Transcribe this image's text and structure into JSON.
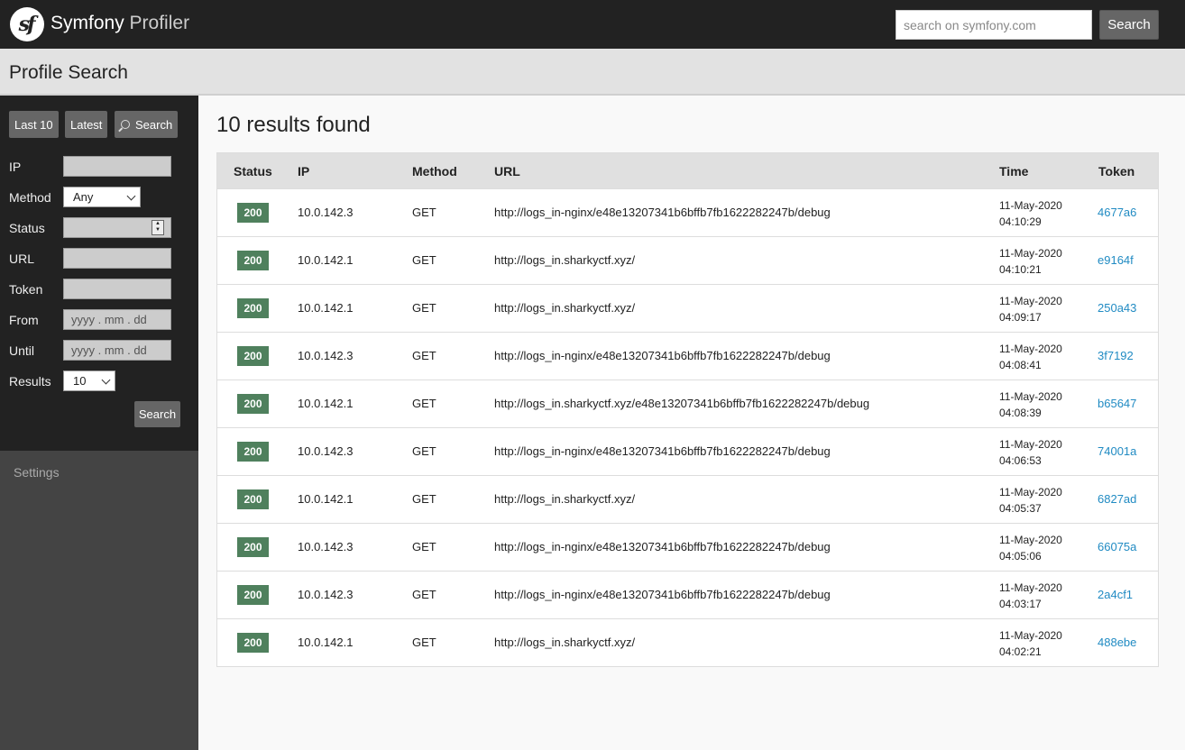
{
  "header": {
    "logo_text": "sf",
    "brand_bold": "Symfony",
    "brand_light": "Profiler",
    "search_placeholder": "search on symfony.com",
    "search_button": "Search"
  },
  "summary": {
    "title": "Profile Search"
  },
  "sidebar": {
    "tabs": {
      "last10": "Last 10",
      "latest": "Latest",
      "search": "Search"
    },
    "labels": {
      "ip": "IP",
      "method": "Method",
      "status": "Status",
      "url": "URL",
      "token": "Token",
      "from": "From",
      "until": "Until",
      "results": "Results"
    },
    "method_value": "Any",
    "date_placeholder": "yyyy . mm . dd",
    "results_value": "10",
    "search_button": "Search",
    "settings": "Settings"
  },
  "content": {
    "heading": "10 results found",
    "columns": {
      "status": "Status",
      "ip": "IP",
      "method": "Method",
      "url": "URL",
      "time": "Time",
      "token": "Token"
    },
    "rows": [
      {
        "status": "200",
        "ip": "10.0.142.3",
        "method": "GET",
        "url": "http://logs_in-nginx/e48e13207341b6bffb7fb1622282247b/debug",
        "date": "11-May-2020",
        "time": "04:10:29",
        "token": "4677a6"
      },
      {
        "status": "200",
        "ip": "10.0.142.1",
        "method": "GET",
        "url": "http://logs_in.sharkyctf.xyz/",
        "date": "11-May-2020",
        "time": "04:10:21",
        "token": "e9164f"
      },
      {
        "status": "200",
        "ip": "10.0.142.1",
        "method": "GET",
        "url": "http://logs_in.sharkyctf.xyz/",
        "date": "11-May-2020",
        "time": "04:09:17",
        "token": "250a43"
      },
      {
        "status": "200",
        "ip": "10.0.142.3",
        "method": "GET",
        "url": "http://logs_in-nginx/e48e13207341b6bffb7fb1622282247b/debug",
        "date": "11-May-2020",
        "time": "04:08:41",
        "token": "3f7192"
      },
      {
        "status": "200",
        "ip": "10.0.142.1",
        "method": "GET",
        "url": "http://logs_in.sharkyctf.xyz/e48e13207341b6bffb7fb1622282247b/debug",
        "date": "11-May-2020",
        "time": "04:08:39",
        "token": "b65647"
      },
      {
        "status": "200",
        "ip": "10.0.142.3",
        "method": "GET",
        "url": "http://logs_in-nginx/e48e13207341b6bffb7fb1622282247b/debug",
        "date": "11-May-2020",
        "time": "04:06:53",
        "token": "74001a"
      },
      {
        "status": "200",
        "ip": "10.0.142.1",
        "method": "GET",
        "url": "http://logs_in.sharkyctf.xyz/",
        "date": "11-May-2020",
        "time": "04:05:37",
        "token": "6827ad"
      },
      {
        "status": "200",
        "ip": "10.0.142.3",
        "method": "GET",
        "url": "http://logs_in-nginx/e48e13207341b6bffb7fb1622282247b/debug",
        "date": "11-May-2020",
        "time": "04:05:06",
        "token": "66075a"
      },
      {
        "status": "200",
        "ip": "10.0.142.3",
        "method": "GET",
        "url": "http://logs_in-nginx/e48e13207341b6bffb7fb1622282247b/debug",
        "date": "11-May-2020",
        "time": "04:03:17",
        "token": "2a4cf1"
      },
      {
        "status": "200",
        "ip": "10.0.142.1",
        "method": "GET",
        "url": "http://logs_in.sharkyctf.xyz/",
        "date": "11-May-2020",
        "time": "04:02:21",
        "token": "488ebe"
      }
    ]
  }
}
